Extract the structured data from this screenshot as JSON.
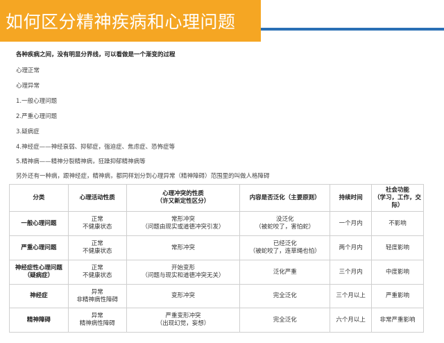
{
  "header": {
    "title": "如何区分精神疾病和心理问题"
  },
  "intro": {
    "lead": "各种疾病之间，没有明显分界线，可以看做是一个渐变的过程",
    "items": [
      "心理正常",
      "心理异常",
      "1.一般心理问题",
      "2.严重心理问题",
      "3.疑病症",
      "4.神经症——神经衰弱、抑郁症，强迫症、焦虑症、恐怖症等",
      "5.精神病——精神分裂精神病，狂躁抑郁精神病等",
      "另外还有一种病，跟神经症，精神病，都同样划分到心理异常（精神障碍）范围里的叫做人格障碍"
    ]
  },
  "table": {
    "headers": [
      [
        "分类"
      ],
      [
        "心理活动性质"
      ],
      [
        "心理冲突的性质",
        "（许又新定性区分）"
      ],
      [
        "内容是否泛化（主要原则）"
      ],
      [
        "持续时间"
      ],
      [
        "社会功能",
        "（学习，工作，交际）"
      ]
    ],
    "rows": [
      [
        [
          "一般心理问题"
        ],
        [
          "正常",
          "不健康状态"
        ],
        [
          "常形冲突",
          "（问题由现实或道德冲突引发）"
        ],
        [
          "没泛化",
          "（被蛇咬了，害怕蛇）"
        ],
        [
          "一个月内"
        ],
        [
          "不影响"
        ]
      ],
      [
        [
          "严重心理问题"
        ],
        [
          "正常",
          "不健康状态"
        ],
        [
          "常形冲突"
        ],
        [
          "已经泛化",
          "（被蛇咬了，连草绳也怕）"
        ],
        [
          "两个月内"
        ],
        [
          "轻度影响"
        ]
      ],
      [
        [
          "神经症性心理问题",
          "（疑病症）"
        ],
        [
          "正常",
          "不健康状态"
        ],
        [
          "开始变形",
          "（问题与现实和道德冲突无关）"
        ],
        [
          "泛化严重"
        ],
        [
          "三个月内"
        ],
        [
          "中度影响"
        ]
      ],
      [
        [
          "神经症"
        ],
        [
          "异常",
          "非精神病性障碍"
        ],
        [
          "变形冲突"
        ],
        [
          "完全泛化"
        ],
        [
          "三个月以上"
        ],
        [
          "严重影响"
        ]
      ],
      [
        [
          "精神障碍"
        ],
        [
          "异常",
          "精神病性障碍"
        ],
        [
          "严重变形冲突",
          "（出现幻觉，妄想）"
        ],
        [
          "完全泛化"
        ],
        [
          "六个月以上"
        ],
        [
          "非常严重影响"
        ]
      ]
    ]
  },
  "colors": {
    "title_bg": "#f5a623",
    "title_text": "#ffffff",
    "accent_line": "#2a6fb5"
  }
}
